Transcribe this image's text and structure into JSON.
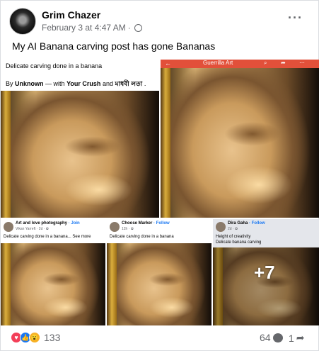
{
  "post": {
    "author": "Grim Chazer",
    "timestamp": "February 3 at 4:47 AM",
    "separator": "·",
    "privacy_icon": "globe-icon",
    "more_icon": "···",
    "caption": "My AI Banana carving post has gone Bananas"
  },
  "tiles": {
    "t1": {
      "title": "Delicate carving done in a banana",
      "by": "By",
      "by_name": "Unknown",
      "with": "— with",
      "friend1": "Your Crush",
      "and": "and",
      "friend2": "মাধবী লতা",
      "end": "."
    },
    "t2": {
      "back": "←",
      "page": "Guerrilla Art",
      "icons": [
        "search-icon",
        "share-icon",
        "more-icon"
      ]
    },
    "b1": {
      "name": "Art and love photography",
      "action": "· Join",
      "sub": "Vikan Yarreft · 2d · ✿",
      "text": "Delicate carving done in a banana... See more"
    },
    "b2": {
      "name": "Choose Marker",
      "action": "· Follow",
      "sub": "12h · ✿",
      "text": "Delicate carving done in a banana"
    },
    "b3": {
      "name": "Dira Gaha",
      "action": "· Follow",
      "sub": "2d · ✿",
      "text": "Height of creativity",
      "text2": "Delicate banana carving",
      "overlay": "+7"
    }
  },
  "footer": {
    "reaction_icons": [
      "love-icon",
      "like-icon",
      "wow-icon"
    ],
    "reaction_count": "133",
    "comment_count": "64",
    "share_count": "1"
  },
  "colors": {
    "accent": "#1877f2",
    "text_secondary": "#65676b",
    "love": "#f33e58",
    "wow": "#f7b125",
    "app_bar": "#e2503a"
  }
}
